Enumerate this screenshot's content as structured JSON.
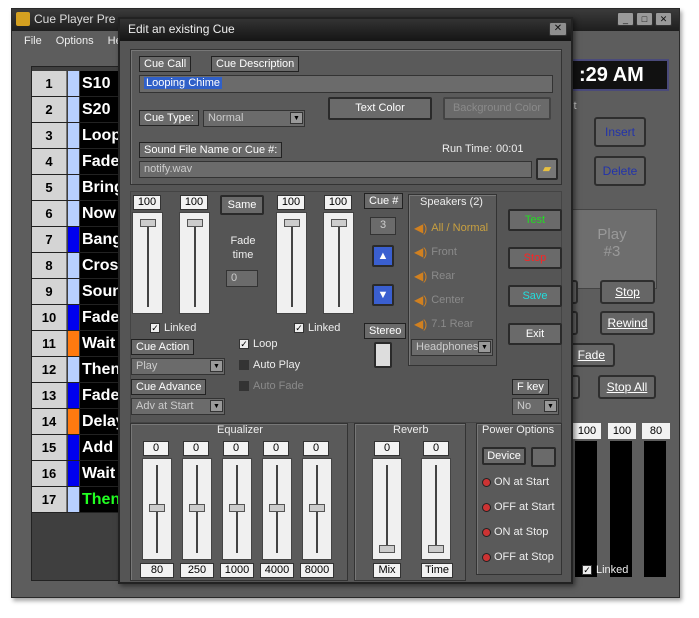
{
  "main_window": {
    "title": "Cue Player Pre",
    "menu": [
      "File",
      "Options",
      "Help"
    ],
    "clock": ":29 AM",
    "cue_rows": [
      {
        "num": "1",
        "text": "S10",
        "bar": "#b8d0ff",
        "color": "#ffffff"
      },
      {
        "num": "2",
        "text": "S20",
        "bar": "#b8d0ff",
        "color": "#ffffff"
      },
      {
        "num": "3",
        "text": "Loop",
        "bar": "#b8d0ff",
        "color": "#ffffff"
      },
      {
        "num": "4",
        "text": "Fade",
        "bar": "#b8d0ff",
        "color": "#ffffff"
      },
      {
        "num": "5",
        "text": "Bring",
        "bar": "#b8d0ff",
        "color": "#ffffff"
      },
      {
        "num": "6",
        "text": "Now",
        "bar": "#b8d0ff",
        "color": "#ffffff"
      },
      {
        "num": "7",
        "text": "Bang",
        "bar": "#0000ee",
        "color": "#ffffff"
      },
      {
        "num": "8",
        "text": "Cross",
        "bar": "#b8d0ff",
        "color": "#ffffff"
      },
      {
        "num": "9",
        "text": "Sound",
        "bar": "#b8d0ff",
        "color": "#ffffff"
      },
      {
        "num": "10",
        "text": "Fade",
        "bar": "#0000ee",
        "color": "#ffffff"
      },
      {
        "num": "11",
        "text": "Wait",
        "bar": "#ff7a10",
        "color": "#ffffff"
      },
      {
        "num": "12",
        "text": "Then",
        "bar": "#b8d0ff",
        "color": "#ffffff"
      },
      {
        "num": "13",
        "text": "Fade",
        "bar": "#0000ee",
        "color": "#ffffff"
      },
      {
        "num": "14",
        "text": "Delay",
        "bar": "#ff7a10",
        "color": "#ffffff"
      },
      {
        "num": "15",
        "text": "Add",
        "bar": "#0000ee",
        "color": "#ffffff"
      },
      {
        "num": "16",
        "text": "Wait",
        "bar": "#0000ee",
        "color": "#ffffff"
      },
      {
        "num": "17",
        "text": "Then",
        "bar": "#b8d0ff",
        "color": "#22ff22"
      }
    ],
    "right_buttons": {
      "insert": "Insert",
      "delete": "Delete",
      "play_line1": "Play",
      "play_line2": "#3",
      "stop": "Stop",
      "rewind": "Rewind",
      "fade": "Fade",
      "stop_all": "Stop All",
      "list_label": "st"
    },
    "master_faders": {
      "values": [
        "100",
        "100",
        "80"
      ],
      "linked_label": "Linked"
    }
  },
  "dialog": {
    "title": "Edit an existing Cue",
    "close_glyph": "✕",
    "cue_call_label": "Cue Call",
    "cue_description_label": "Cue Description",
    "cue_description_value": "Looping Chime",
    "text_color_button": "Text Color",
    "background_color_button": "Background Color",
    "cue_type_label": "Cue Type:",
    "cue_type_value": "Normal",
    "sound_file_label": "Sound File Name or Cue #:",
    "sound_file_value": "notify.wav",
    "run_time_label": "Run Time:",
    "run_time_value": "00:01",
    "left_faders": {
      "values": [
        "100",
        "100"
      ],
      "linked": "Linked"
    },
    "same_button": "Same",
    "fade_time_label": "Fade time",
    "fade_time_value": "0",
    "right_faders": {
      "values": [
        "100",
        "100"
      ],
      "linked": "Linked"
    },
    "cue_num_label": "Cue #",
    "cue_num_value": "3",
    "stereo_label": "Stereo",
    "speakers_title": "Speakers (2)",
    "speakers": [
      "All / Normal",
      "Front",
      "Rear",
      "Center",
      "7.1 Rear"
    ],
    "speaker_output": "Headphones",
    "test_button": "Test",
    "stop_button": "Stop",
    "save_button": "Save",
    "exit_button": "Exit",
    "cue_action_label": "Cue Action",
    "cue_action_value": "Play",
    "loop_label": "Loop",
    "auto_play_label": "Auto Play",
    "auto_fade_label": "Auto Fade",
    "cue_advance_label": "Cue Advance",
    "cue_advance_value": "Adv at Start",
    "fkey_label": "F key",
    "fkey_value": "No",
    "equalizer": {
      "title": "Equalizer",
      "values": [
        "0",
        "0",
        "0",
        "0",
        "0"
      ],
      "bands": [
        "80",
        "250",
        "1000",
        "4000",
        "8000"
      ]
    },
    "reverb": {
      "title": "Reverb",
      "values": [
        "0",
        "0"
      ],
      "labels": [
        "Mix",
        "Time"
      ]
    },
    "power_options": {
      "title": "Power Options",
      "device_button": "Device",
      "items": [
        "ON at Start",
        "OFF at Start",
        "ON at Stop",
        "OFF at Stop"
      ]
    },
    "colors": {
      "test": "#22dd22",
      "stop": "#ff2222",
      "save": "#22dddd",
      "accent_gold": "#c8a040"
    }
  }
}
